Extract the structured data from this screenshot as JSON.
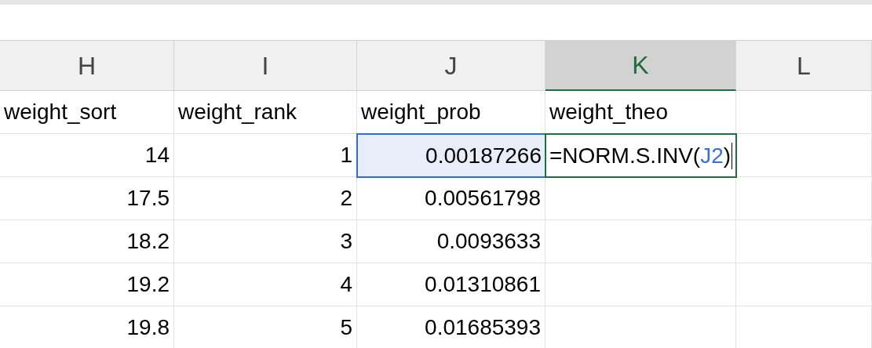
{
  "columns": [
    {
      "label": "H",
      "selected": false
    },
    {
      "label": "I",
      "selected": false
    },
    {
      "label": "J",
      "selected": false
    },
    {
      "label": "K",
      "selected": true
    },
    {
      "label": "L",
      "selected": false
    }
  ],
  "rows": [
    {
      "cells": [
        {
          "kind": "text",
          "text": "weight_sort",
          "selected": false
        },
        {
          "kind": "text",
          "text": "weight_rank",
          "selected": false
        },
        {
          "kind": "text",
          "text": "weight_prob",
          "selected": false
        },
        {
          "kind": "text",
          "text": "weight_theo",
          "selected": false
        },
        {
          "kind": "empty",
          "selected": false
        }
      ]
    },
    {
      "cells": [
        {
          "kind": "number",
          "text": "14",
          "selected": false
        },
        {
          "kind": "number",
          "text": "1",
          "selected": false
        },
        {
          "kind": "number",
          "text": "0.00187266",
          "selected": true
        },
        {
          "kind": "formula",
          "parts": [
            {
              "kind": "plain",
              "text": "=NORM.S.INV("
            },
            {
              "kind": "ref",
              "text": "J2"
            },
            {
              "kind": "plain",
              "text": ")"
            }
          ],
          "selected": false
        },
        {
          "kind": "empty",
          "selected": false
        }
      ]
    },
    {
      "cells": [
        {
          "kind": "number",
          "text": "17.5",
          "selected": false
        },
        {
          "kind": "number",
          "text": "2",
          "selected": false
        },
        {
          "kind": "number",
          "text": "0.00561798",
          "selected": false
        },
        {
          "kind": "empty",
          "selected": false
        },
        {
          "kind": "empty",
          "selected": false
        }
      ]
    },
    {
      "cells": [
        {
          "kind": "number",
          "text": "18.2",
          "selected": false
        },
        {
          "kind": "number",
          "text": "3",
          "selected": false
        },
        {
          "kind": "number",
          "text": "0.0093633",
          "selected": false
        },
        {
          "kind": "empty",
          "selected": false
        },
        {
          "kind": "empty",
          "selected": false
        }
      ]
    },
    {
      "cells": [
        {
          "kind": "number",
          "text": "19.2",
          "selected": false
        },
        {
          "kind": "number",
          "text": "4",
          "selected": false
        },
        {
          "kind": "number",
          "text": "0.01310861",
          "selected": false
        },
        {
          "kind": "empty",
          "selected": false
        },
        {
          "kind": "empty",
          "selected": false
        }
      ]
    },
    {
      "cells": [
        {
          "kind": "number",
          "text": "19.8",
          "selected": false
        },
        {
          "kind": "number",
          "text": "5",
          "selected": false
        },
        {
          "kind": "number",
          "text": "0.01685393",
          "selected": false
        },
        {
          "kind": "empty",
          "selected": false
        },
        {
          "kind": "empty",
          "selected": false
        }
      ]
    }
  ]
}
